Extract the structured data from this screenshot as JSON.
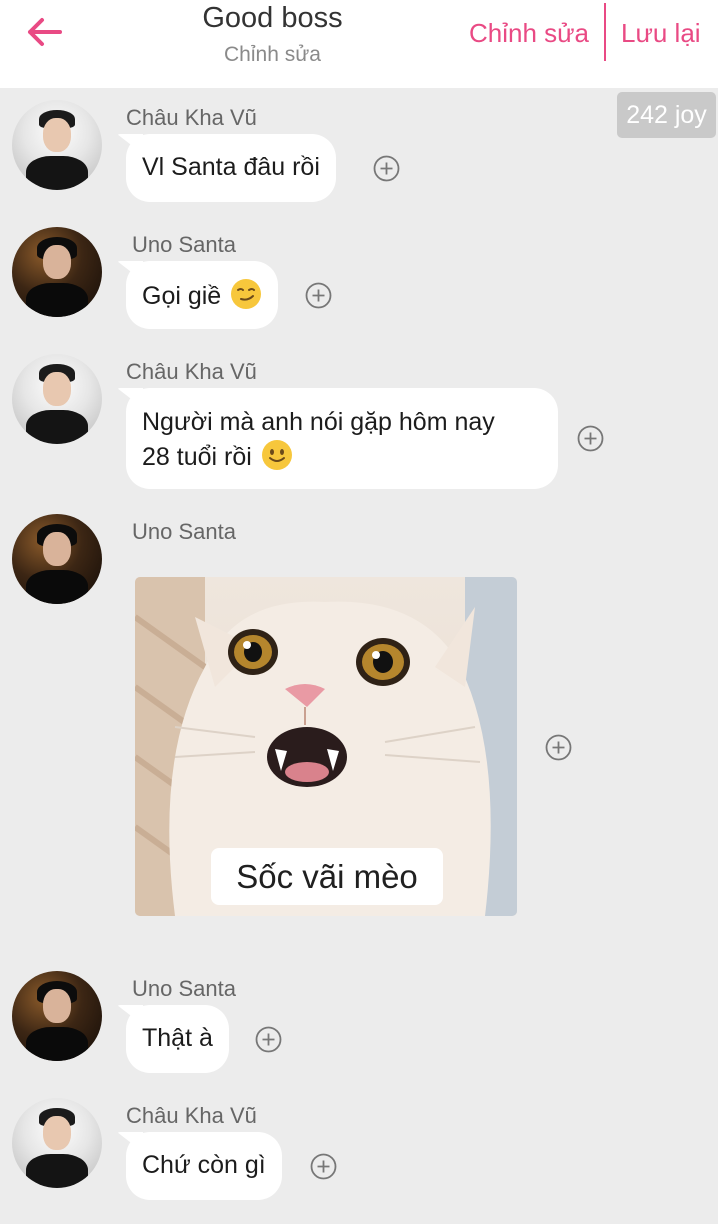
{
  "header": {
    "title": "Good boss",
    "subtitle": "Chỉnh sửa",
    "edit_label": "Chỉnh sửa",
    "save_label": "Lưu lại"
  },
  "badge": {
    "text": "242 joy"
  },
  "messages": [
    {
      "sender": "Châu Kha Vũ",
      "text": "Vl Santa đâu rồi"
    },
    {
      "sender": "Uno Santa",
      "text": "Gọi giề",
      "emoji": "smirk-emoji"
    },
    {
      "sender": "Châu Kha Vũ",
      "line1": "Người mà anh nói gặp hôm nay",
      "line2": "28 tuổi rồi",
      "emoji": "smile-emoji"
    },
    {
      "sender": "Uno Santa",
      "image_caption": "Sốc vãi mèo"
    },
    {
      "sender": "Uno Santa",
      "text": "Thật à"
    },
    {
      "sender": "Châu Kha Vũ",
      "text": "Chứ còn gì"
    }
  ],
  "colors": {
    "accent": "#e94a84",
    "background": "#ececec",
    "bubble": "#ffffff"
  },
  "icons": {
    "back": "back-arrow-icon",
    "add": "add-circle-icon"
  }
}
